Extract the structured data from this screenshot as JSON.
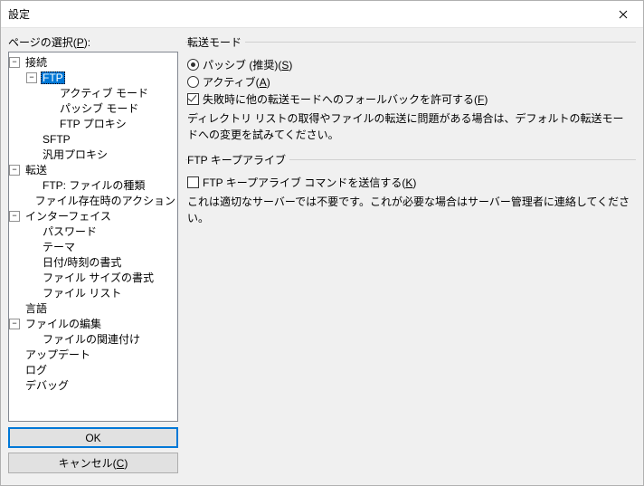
{
  "window": {
    "title": "設定"
  },
  "left": {
    "label": "ページの選択(P):",
    "tree": {
      "connection": "接続",
      "ftp": "FTP",
      "activeMode": "アクティブ モード",
      "passiveMode": "パッシブ モード",
      "ftpProxy": "FTP プロキシ",
      "sftp": "SFTP",
      "genericProxy": "汎用プロキシ",
      "transfer": "転送",
      "ftpFileTypes": "FTP: ファイルの種類",
      "fileExistsAction": "ファイル存在時のアクション",
      "interface": "インターフェイス",
      "password": "パスワード",
      "theme": "テーマ",
      "dateTimeFormat": "日付/時刻の書式",
      "fileSizeFormat": "ファイル サイズの書式",
      "fileList": "ファイル リスト",
      "language": "言語",
      "fileEditing": "ファイルの編集",
      "fileAssoc": "ファイルの関連付け",
      "update": "アップデート",
      "log": "ログ",
      "debug": "デバッグ"
    },
    "buttons": {
      "ok": "OK",
      "cancel": "キャンセル(C)"
    }
  },
  "right": {
    "transferMode": {
      "legend": "転送モード",
      "passive": "パッシブ (推奨)(S)",
      "active": "アクティブ(A)",
      "fallback": "失敗時に他の転送モードへのフォールバックを許可する(F)",
      "desc": "ディレクトリ リストの取得やファイルの転送に問題がある場合は、デフォルトの転送モードへの変更を試みてください。"
    },
    "keepalive": {
      "legend": "FTP キープアライブ",
      "check": "FTP キープアライブ コマンドを送信する(K)",
      "desc": "これは適切なサーバーでは不要です。これが必要な場合はサーバー管理者に連絡してください。"
    }
  }
}
